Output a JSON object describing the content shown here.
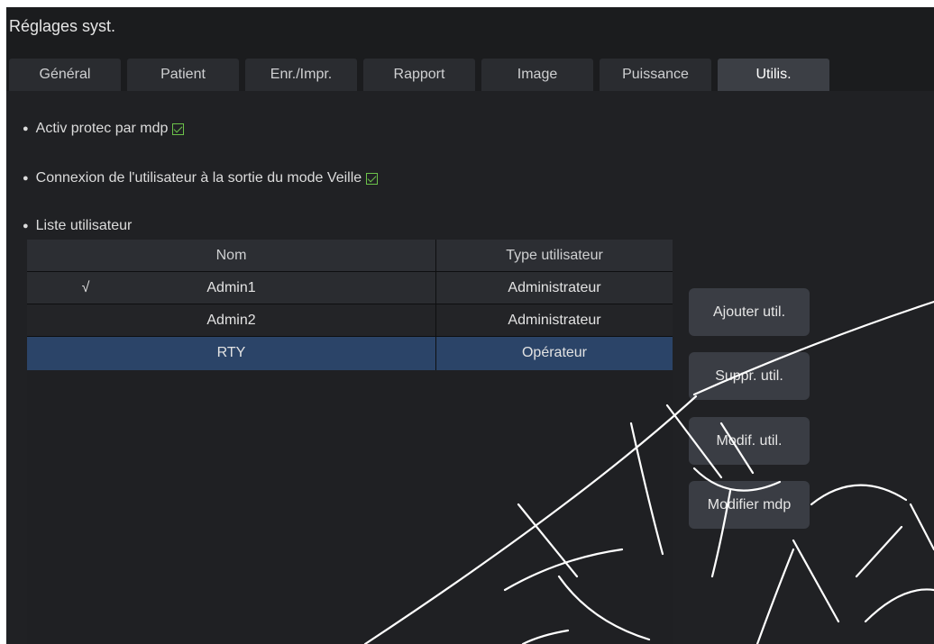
{
  "window": {
    "title": "Réglages syst."
  },
  "tabs": [
    {
      "label": "Général"
    },
    {
      "label": "Patient"
    },
    {
      "label": "Enr./Impr."
    },
    {
      "label": "Rapport"
    },
    {
      "label": "Image"
    },
    {
      "label": "Puissance"
    },
    {
      "label": "Utilis.",
      "active": true
    }
  ],
  "options": {
    "password_protect": {
      "label": "Activ protec par mdp",
      "checked": true
    },
    "login_on_wake": {
      "label": "Connexion de l'utilisateur à la sortie du mode Veille",
      "checked": true
    },
    "user_list_label": "Liste utilisateur"
  },
  "user_table": {
    "columns": [
      "Nom",
      "Type utilisateur"
    ],
    "rows": [
      {
        "mark": "√",
        "name": "Admin1",
        "type": "Administrateur"
      },
      {
        "mark": "",
        "name": "Admin2",
        "type": "Administrateur"
      },
      {
        "mark": "",
        "name": "RTY",
        "type": "Opérateur",
        "selected": true
      }
    ]
  },
  "buttons": {
    "add": "Ajouter util.",
    "delete": "Suppr. util.",
    "modify": "Modif. util.",
    "change_password": "Modifier mdp"
  },
  "colors": {
    "selected_row": "#2b4468",
    "checkbox": "#6cc24a",
    "background": "#1b1c1e"
  }
}
